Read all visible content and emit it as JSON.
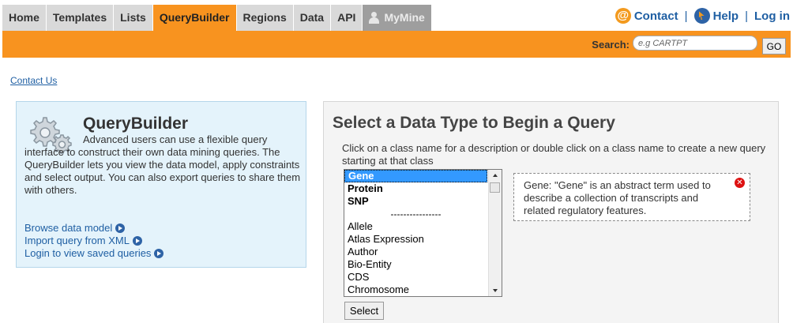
{
  "nav": {
    "tabs": [
      "Home",
      "Templates",
      "Lists",
      "QueryBuilder",
      "Regions",
      "Data",
      "API"
    ],
    "mymine_label": "MyMine",
    "active_tab": "QueryBuilder",
    "links": {
      "contact": "Contact",
      "help": "Help",
      "login": "Log in"
    },
    "separators": [
      "|",
      "|"
    ]
  },
  "search": {
    "label": "Search:",
    "placeholder": "e.g CARTPT",
    "go_label": "GO"
  },
  "contact_us": "Contact Us",
  "querybuilder_panel": {
    "title": "QueryBuilder",
    "description": "Advanced users can use a flexible query interface to construct their own data mining queries. The QueryBuilder lets you view the data model, apply constraints and select output. You can also export queries to share them with others.",
    "links": [
      "Browse data model",
      "Import query from XML",
      "Login to view saved queries"
    ]
  },
  "data_type_panel": {
    "title": "Select a Data Type to Begin a Query",
    "instructions": "Click on a class name for a description or double click on a class name to create a new query starting at that class",
    "classes_top": [
      "Gene",
      "Protein",
      "SNP"
    ],
    "divider": "----------------",
    "classes": [
      "Allele",
      "Atlas Expression",
      "Author",
      "Bio-Entity",
      "CDS",
      "Chromosome"
    ],
    "selected_class": "Gene",
    "select_label": "Select",
    "description": "Gene: \"Gene\" is an abstract term used to describe a collection of transcripts and related regulatory features."
  },
  "colors": {
    "orange": "#f8931f",
    "link_blue": "#1f5fa3",
    "panel_blue": "#e4f3fb",
    "selected_blue": "#3399ff"
  }
}
